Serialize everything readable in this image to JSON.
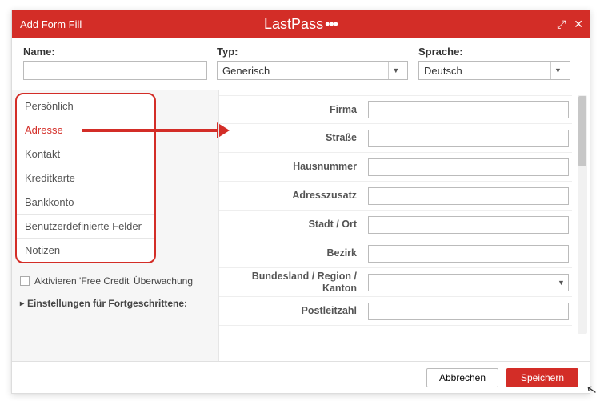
{
  "window": {
    "title": "Add Form Fill",
    "brand": "LastPass",
    "dots": "•••"
  },
  "toprow": {
    "name_label": "Name:",
    "name_value": "",
    "type_label": "Typ:",
    "type_value": "Generisch",
    "language_label": "Sprache:",
    "language_value": "Deutsch"
  },
  "tabs": [
    "Persönlich",
    "Adresse",
    "Kontakt",
    "Kreditkarte",
    "Bankkonto",
    "Benutzerdefinierte Felder",
    "Notizen"
  ],
  "active_tab_index": 1,
  "left_extra": {
    "checkbox_label": "Aktivieren 'Free Credit' Überwachung",
    "advanced_label": "Einstellungen für Fortgeschrittene:"
  },
  "form_fields": [
    {
      "label": "Firma",
      "type": "text"
    },
    {
      "label": "Straße",
      "type": "text"
    },
    {
      "label": "Hausnummer",
      "type": "text"
    },
    {
      "label": "Adresszusatz",
      "type": "text"
    },
    {
      "label": "Stadt / Ort",
      "type": "text"
    },
    {
      "label": "Bezirk",
      "type": "text"
    },
    {
      "label": "Bundesland / Region / Kanton",
      "type": "select"
    },
    {
      "label": "Postleitzahl",
      "type": "text"
    }
  ],
  "footer": {
    "cancel": "Abbrechen",
    "save": "Speichern"
  }
}
